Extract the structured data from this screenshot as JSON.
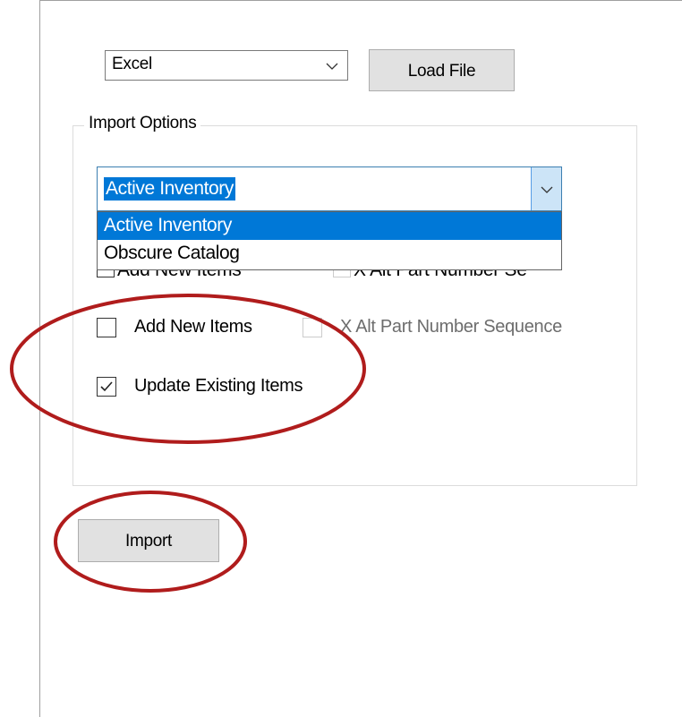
{
  "file_type": {
    "selected": "Excel",
    "chevron_icon": "chevron-down-icon"
  },
  "load_button": {
    "label": "Load File"
  },
  "import_options": {
    "legend": "Import Options",
    "inventory": {
      "selected": "Active Inventory",
      "options": [
        "Active Inventory",
        "Obscure Catalog"
      ],
      "highlighted_index": 0
    },
    "ghost_text": {
      "add": "Add New Items",
      "alt": "X Alt Part Number Se"
    },
    "add_new_items": {
      "label": "Add New Items",
      "checked": false
    },
    "alt_part_number": {
      "label": "X Alt Part Number Sequence",
      "checked": false,
      "enabled": false
    },
    "update_existing": {
      "label": "Update Existing Items",
      "checked": true
    }
  },
  "import_button": {
    "label": "Import"
  },
  "colors": {
    "highlight": "#0078d7",
    "annotation": "#b01c1c",
    "button_face": "#e1e1e1"
  }
}
